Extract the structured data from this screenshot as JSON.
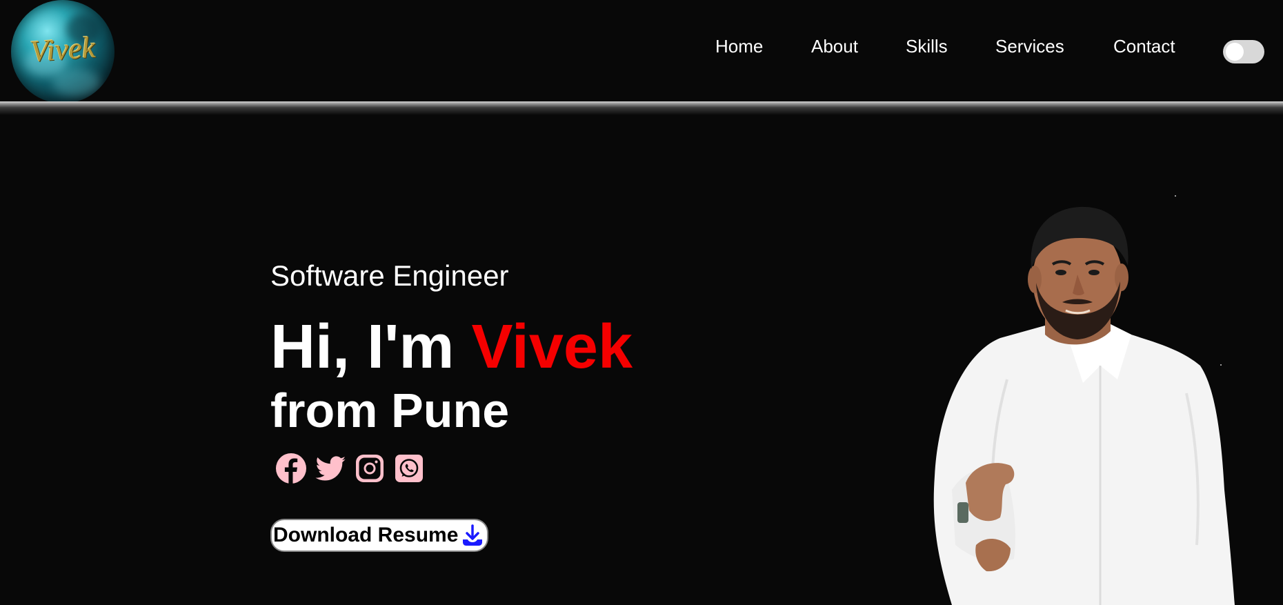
{
  "header": {
    "logo_text": "Vivek",
    "nav": [
      {
        "label": "Home"
      },
      {
        "label": "About"
      },
      {
        "label": "Skills"
      },
      {
        "label": "Services"
      },
      {
        "label": "Contact"
      }
    ],
    "theme_toggle": {
      "state": "off"
    }
  },
  "hero": {
    "subtitle": "Software Engineer",
    "greeting": "Hi, I'm",
    "name": "Vivek",
    "location_line": "from Pune",
    "socials": [
      {
        "icon": "facebook-icon"
      },
      {
        "icon": "twitter-icon"
      },
      {
        "icon": "instagram-icon"
      },
      {
        "icon": "whatsapp-icon"
      }
    ],
    "resume_button": "Download Resume",
    "resume_icon": "download-icon"
  },
  "colors": {
    "background": "#080808",
    "accent_name": "#f50000",
    "social_icon": "#ffc0cb",
    "download_icon": "#1a1aff"
  }
}
